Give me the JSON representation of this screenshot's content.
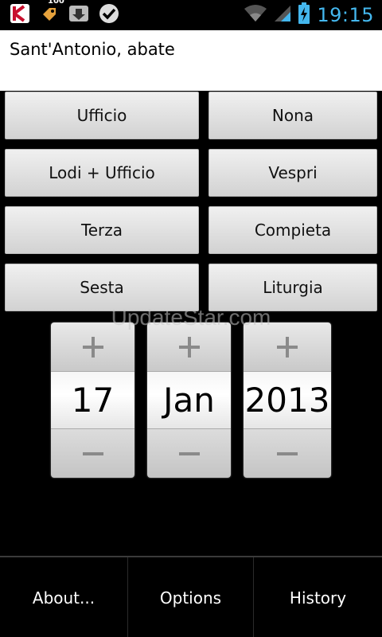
{
  "status_bar": {
    "notification_badge": "100",
    "time": "19:15",
    "icons": [
      "kaspersky-icon",
      "tag-icon",
      "download-icon",
      "check-icon",
      "wifi-icon",
      "signal-icon",
      "battery-icon"
    ],
    "time_color": "#44b7ee"
  },
  "header": {
    "title": "Sant'Antonio, abate"
  },
  "buttons": {
    "ufficio": "Ufficio",
    "nona": "Nona",
    "lodi_ufficio": "Lodi + Ufficio",
    "vespri": "Vespri",
    "terza": "Terza",
    "compieta": "Compieta",
    "sesta": "Sesta",
    "liturgia": "Liturgia"
  },
  "date_picker": {
    "day": "17",
    "month": "Jan",
    "year": "2013"
  },
  "watermark": "UpdateStar.com",
  "menu": {
    "about": "About...",
    "options": "Options",
    "history": "History"
  }
}
